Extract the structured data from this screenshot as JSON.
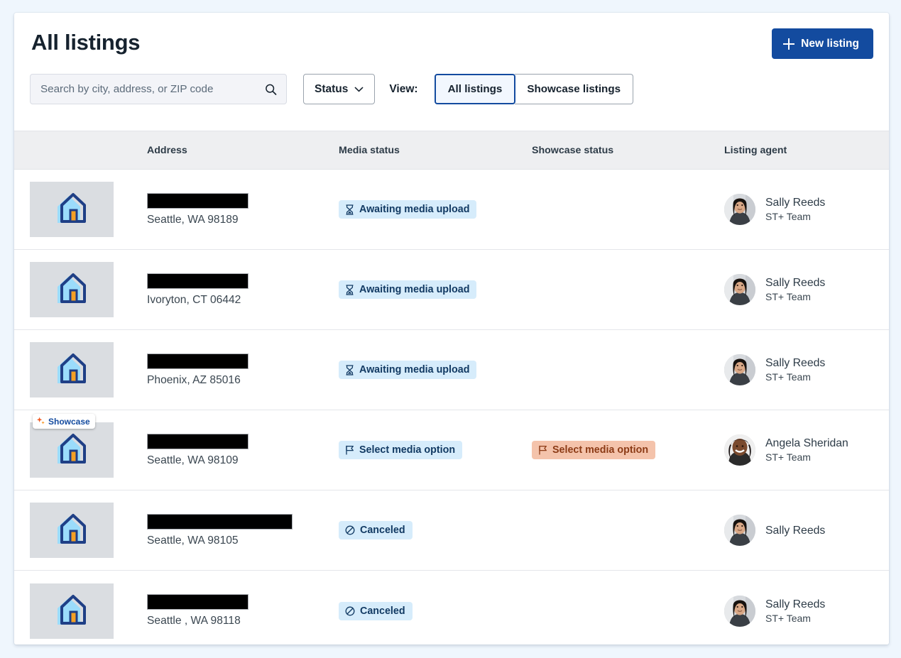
{
  "header": {
    "title": "All listings",
    "new_listing_label": "New listing",
    "plus_icon": "plus-icon"
  },
  "toolbar": {
    "search_placeholder": "Search by city, address, or ZIP code",
    "search_value": "",
    "search_icon": "search-icon",
    "status_label": "Status",
    "chevron_icon": "chevron-down-icon",
    "view_label": "View:",
    "segments": [
      {
        "label": "All listings",
        "active": true
      },
      {
        "label": "Showcase listings",
        "active": false
      }
    ]
  },
  "table": {
    "columns": [
      "",
      "Address",
      "Media status",
      "Showcase status",
      "Listing agent"
    ],
    "rows": [
      {
        "thumbnail_icon": "house-icon",
        "showcase_badge": null,
        "address_redacted": true,
        "address_bar_width": 143,
        "city": "Seattle, WA 98189",
        "media_status": {
          "label": "Awaiting media upload",
          "icon": "hourglass-icon",
          "tone": "blue"
        },
        "showcase_status": null,
        "agent": {
          "name": "Sally Reeds",
          "team": "ST+ Team",
          "avatar": "agent-avatar-sally"
        }
      },
      {
        "thumbnail_icon": "house-icon",
        "showcase_badge": null,
        "address_redacted": true,
        "address_bar_width": 143,
        "city": "Ivoryton, CT 06442",
        "media_status": {
          "label": "Awaiting media upload",
          "icon": "hourglass-icon",
          "tone": "blue"
        },
        "showcase_status": null,
        "agent": {
          "name": "Sally Reeds",
          "team": "ST+ Team",
          "avatar": "agent-avatar-sally"
        }
      },
      {
        "thumbnail_icon": "house-icon",
        "showcase_badge": null,
        "address_redacted": true,
        "address_bar_width": 143,
        "city": "Phoenix, AZ 85016",
        "media_status": {
          "label": "Awaiting media upload",
          "icon": "hourglass-icon",
          "tone": "blue"
        },
        "showcase_status": null,
        "agent": {
          "name": "Sally Reeds",
          "team": "ST+ Team",
          "avatar": "agent-avatar-sally"
        }
      },
      {
        "thumbnail_icon": "house-icon",
        "showcase_badge": {
          "label": "Showcase",
          "icon": "sparkle-icon"
        },
        "address_redacted": true,
        "address_bar_width": 143,
        "city": "Seattle, WA 98109",
        "media_status": {
          "label": "Select media option",
          "icon": "flag-icon",
          "tone": "blue"
        },
        "showcase_status": {
          "label": "Select media option",
          "icon": "flag-icon",
          "tone": "orange"
        },
        "agent": {
          "name": "Angela Sheridan",
          "team": "ST+ Team",
          "avatar": "agent-avatar-angela"
        }
      },
      {
        "thumbnail_icon": "house-icon",
        "showcase_badge": null,
        "address_redacted": true,
        "address_bar_width": 205,
        "city": "Seattle, WA 98105",
        "media_status": {
          "label": "Canceled",
          "icon": "cancel-icon",
          "tone": "blue"
        },
        "showcase_status": null,
        "agent": {
          "name": "Sally Reeds",
          "team": "",
          "avatar": "agent-avatar-sally"
        }
      },
      {
        "thumbnail_icon": "house-icon",
        "showcase_badge": null,
        "address_redacted": true,
        "address_bar_width": 143,
        "city": "Seattle , WA 98118",
        "media_status": {
          "label": "Canceled",
          "icon": "cancel-icon",
          "tone": "blue"
        },
        "showcase_status": null,
        "agent": {
          "name": "Sally Reeds",
          "team": "ST+ Team",
          "avatar": "agent-avatar-sally"
        }
      }
    ]
  },
  "colors": {
    "brand_blue": "#134b9f",
    "badge_blue_bg": "#d6ecfb",
    "badge_blue_text": "#123a63",
    "badge_orange_bg": "#f4c3ab",
    "badge_orange_text": "#8c3b16",
    "accent_orange": "#f08c20",
    "page_bg": "#eff6fd",
    "header_row_bg": "#eeeff1"
  }
}
